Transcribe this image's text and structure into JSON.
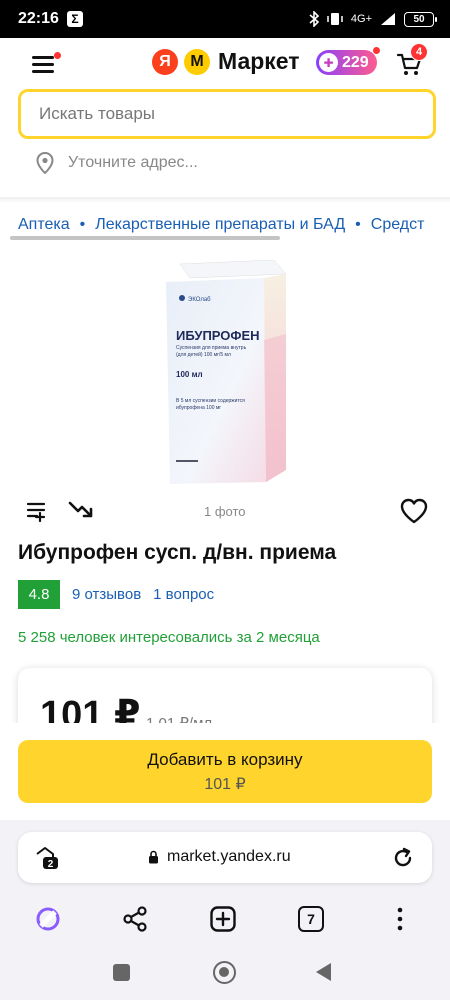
{
  "status": {
    "time": "22:16",
    "sigma": "Σ",
    "network": "4G+",
    "battery": "50"
  },
  "header": {
    "logo_ya": "Я",
    "logo_m": "М",
    "brand": "Маркет",
    "plus_points": "229",
    "cart_count": "4"
  },
  "search": {
    "placeholder": "Искать товары"
  },
  "address": {
    "label": "Уточните адрес..."
  },
  "breadcrumbs": [
    "Аптека",
    "Лекарственные препараты и БАД",
    "Средст"
  ],
  "product": {
    "image_text": {
      "brand": "ЭКОлаб",
      "name": "ИБУПРОФЕН",
      "line1": "Суспензия для приема внутрь",
      "line2": "(для детей) 100 мг/5 мл",
      "volume": "100 мл",
      "comp1": "В 5 мл суспензии содержится",
      "comp2": "ибупрофена 100 мг"
    },
    "photos": "1 фото",
    "title": "Ибупрофен сусп. д/вн. приема",
    "rating": "4.8",
    "reviews": "9 отзывов",
    "questions": "1 вопрос",
    "interest": "5 258 человек интересовались за 2 месяца",
    "price": "101 ₽",
    "unit_price": "1,01 ₽/мл"
  },
  "cart_button": {
    "label": "Добавить в корзину",
    "price": "101 ₽"
  },
  "browser": {
    "tabs_count": "2",
    "url": "market.yandex.ru",
    "open_tabs": "7"
  },
  "colors": {
    "accent": "#ffd42d",
    "link": "#1a5fb4",
    "rating": "#21a038",
    "badge": "#ff3333"
  }
}
